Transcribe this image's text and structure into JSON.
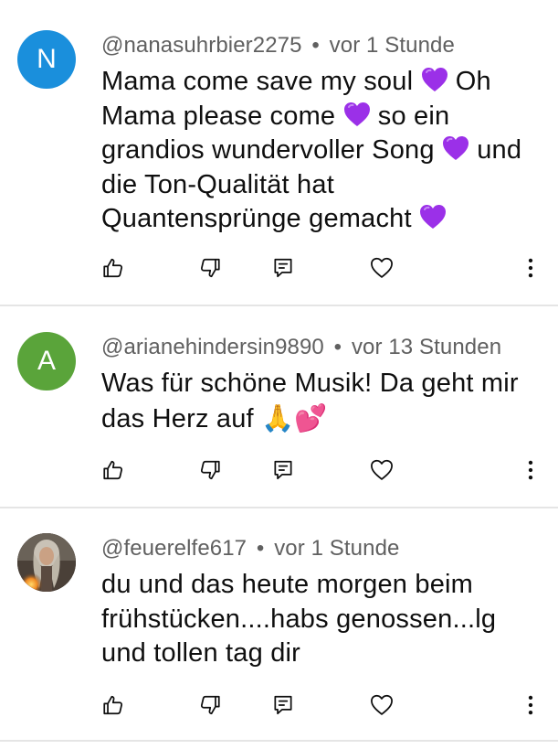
{
  "comments": [
    {
      "avatar_letter": "N",
      "avatar_color": "#1a8fdc",
      "username": "@nanasuhrbier2275",
      "separator": "•",
      "time": "vor 1 Stunde",
      "text_parts": [
        "Mama come save my soul ",
        " Oh Mama please come ",
        " so ein grandios wundervoller Song ",
        " und die Ton-Qualität hat Quantensprünge gemacht "
      ],
      "emoji": "purple-heart-icon"
    },
    {
      "avatar_letter": "A",
      "avatar_color": "#5aa43a",
      "username": "@arianehindersin9890",
      "separator": "•",
      "time": "vor 13 Stunden",
      "text": "Was für schöne Musik! Da geht mir das Herz auf ",
      "emoji_1": "🙏",
      "emoji_2": "💕"
    },
    {
      "avatar_type": "photo",
      "username": "@feuerelfe617",
      "separator": "•",
      "time": "vor 1 Stunde",
      "text": "du und das heute morgen beim frühstücken....habs genossen...lg und tollen tag dir"
    }
  ],
  "actions": [
    "like-icon",
    "dislike-icon",
    "reply-icon",
    "heart-icon",
    "more-vert-icon"
  ],
  "colors": {
    "meta": "#606060",
    "text": "#0f0f0f",
    "divider": "#e5e5e5",
    "purple_heart": "#9b30e8"
  }
}
